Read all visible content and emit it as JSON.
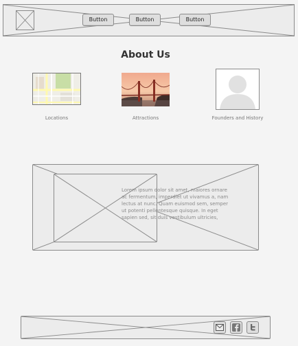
{
  "header": {
    "nav_buttons": [
      {
        "label": "Button"
      },
      {
        "label": "Button"
      },
      {
        "label": "Button"
      }
    ]
  },
  "main": {
    "title": "About Us",
    "features": [
      {
        "label": "Locations",
        "icon": "map-image"
      },
      {
        "label": "Attractions",
        "icon": "golden-gate-bridge-image"
      },
      {
        "label": "Founders and History",
        "icon": "user-avatar-image"
      }
    ],
    "content_text": "Lorem ipsum dolor sit amet, maiores ornare ac fermentum, imperdiet ut vivamus a, nam lectus at nunc. Quam euismod sem, semper ut potenti pellentesque quisque. In eget sapien sed, sit duis vestibulum ultricies,"
  },
  "footer": {
    "social_icons": [
      "mail-icon",
      "facebook-icon",
      "twitter-icon"
    ]
  },
  "colors": {
    "background": "#f4f4f4",
    "placeholder_fill": "#ececec",
    "placeholder_border": "#8a8a8a",
    "button_fill": "#dedede"
  }
}
